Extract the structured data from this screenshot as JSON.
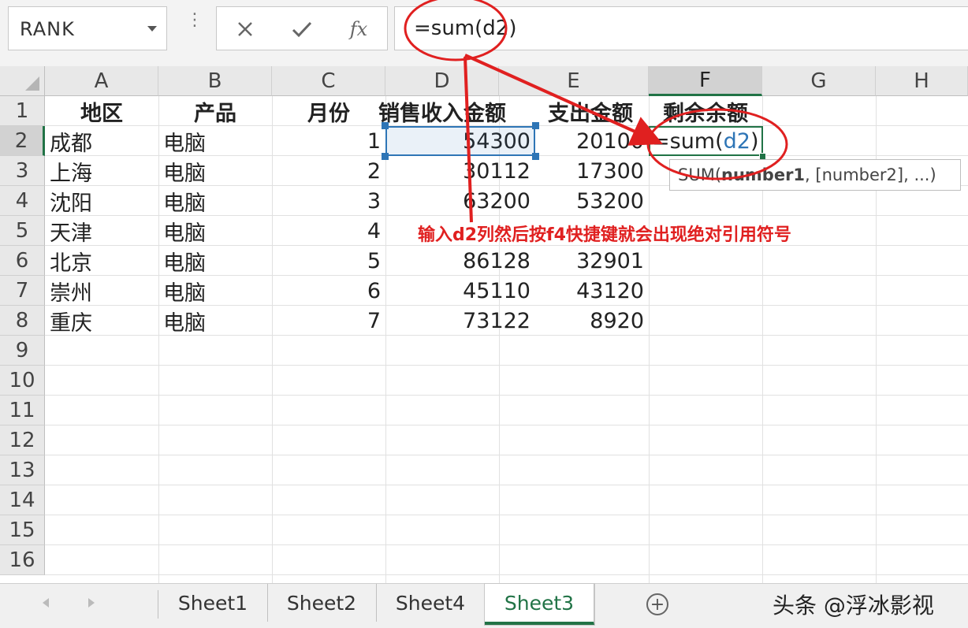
{
  "name_box": "RANK",
  "formula_bar": {
    "cancel_icon": "close-icon",
    "enter_icon": "check-icon",
    "fx_label": "fx",
    "content": "=sum(d2)"
  },
  "columns": [
    "A",
    "B",
    "C",
    "D",
    "E",
    "F",
    "G",
    "H"
  ],
  "rows": [
    "1",
    "2",
    "3",
    "4",
    "5",
    "6",
    "7",
    "8",
    "9",
    "10",
    "11",
    "12",
    "13",
    "14",
    "15",
    "16"
  ],
  "headers": {
    "a": "地区",
    "b": "产品",
    "c": "月份",
    "d": "销售收入金额",
    "e": "支出金额",
    "f": "剩余余额"
  },
  "data_rows": [
    {
      "region": "成都",
      "product": "电脑",
      "month": "1",
      "sales": "54300",
      "expense": "20100"
    },
    {
      "region": "上海",
      "product": "电脑",
      "month": "2",
      "sales": "30112",
      "expense": "17300"
    },
    {
      "region": "沈阳",
      "product": "电脑",
      "month": "3",
      "sales": "63200",
      "expense": "53200"
    },
    {
      "region": "天津",
      "product": "电脑",
      "month": "4",
      "sales": "",
      "expense": ""
    },
    {
      "region": "北京",
      "product": "电脑",
      "month": "5",
      "sales": "86128",
      "expense": "32901"
    },
    {
      "region": "崇州",
      "product": "电脑",
      "month": "6",
      "sales": "45110",
      "expense": "43120"
    },
    {
      "region": "重庆",
      "product": "电脑",
      "month": "7",
      "sales": "73122",
      "expense": "8920"
    }
  ],
  "editing_cell": {
    "prefix": "=sum(",
    "ref": "d2",
    "suffix": ")"
  },
  "tooltip": {
    "func": "SUM(",
    "arg1": "number1",
    "rest": ", [number2], ...)"
  },
  "annotation": "输入d2列然后按f4快捷键就会出现绝对引用符号",
  "sheets": [
    "Sheet1",
    "Sheet2",
    "Sheet4",
    "Sheet3"
  ],
  "active_sheet": "Sheet3",
  "watermark": "头条 @浮冰影视",
  "colors": {
    "accent": "#217346",
    "annotation": "#e02020",
    "ref": "#2e75b6"
  }
}
